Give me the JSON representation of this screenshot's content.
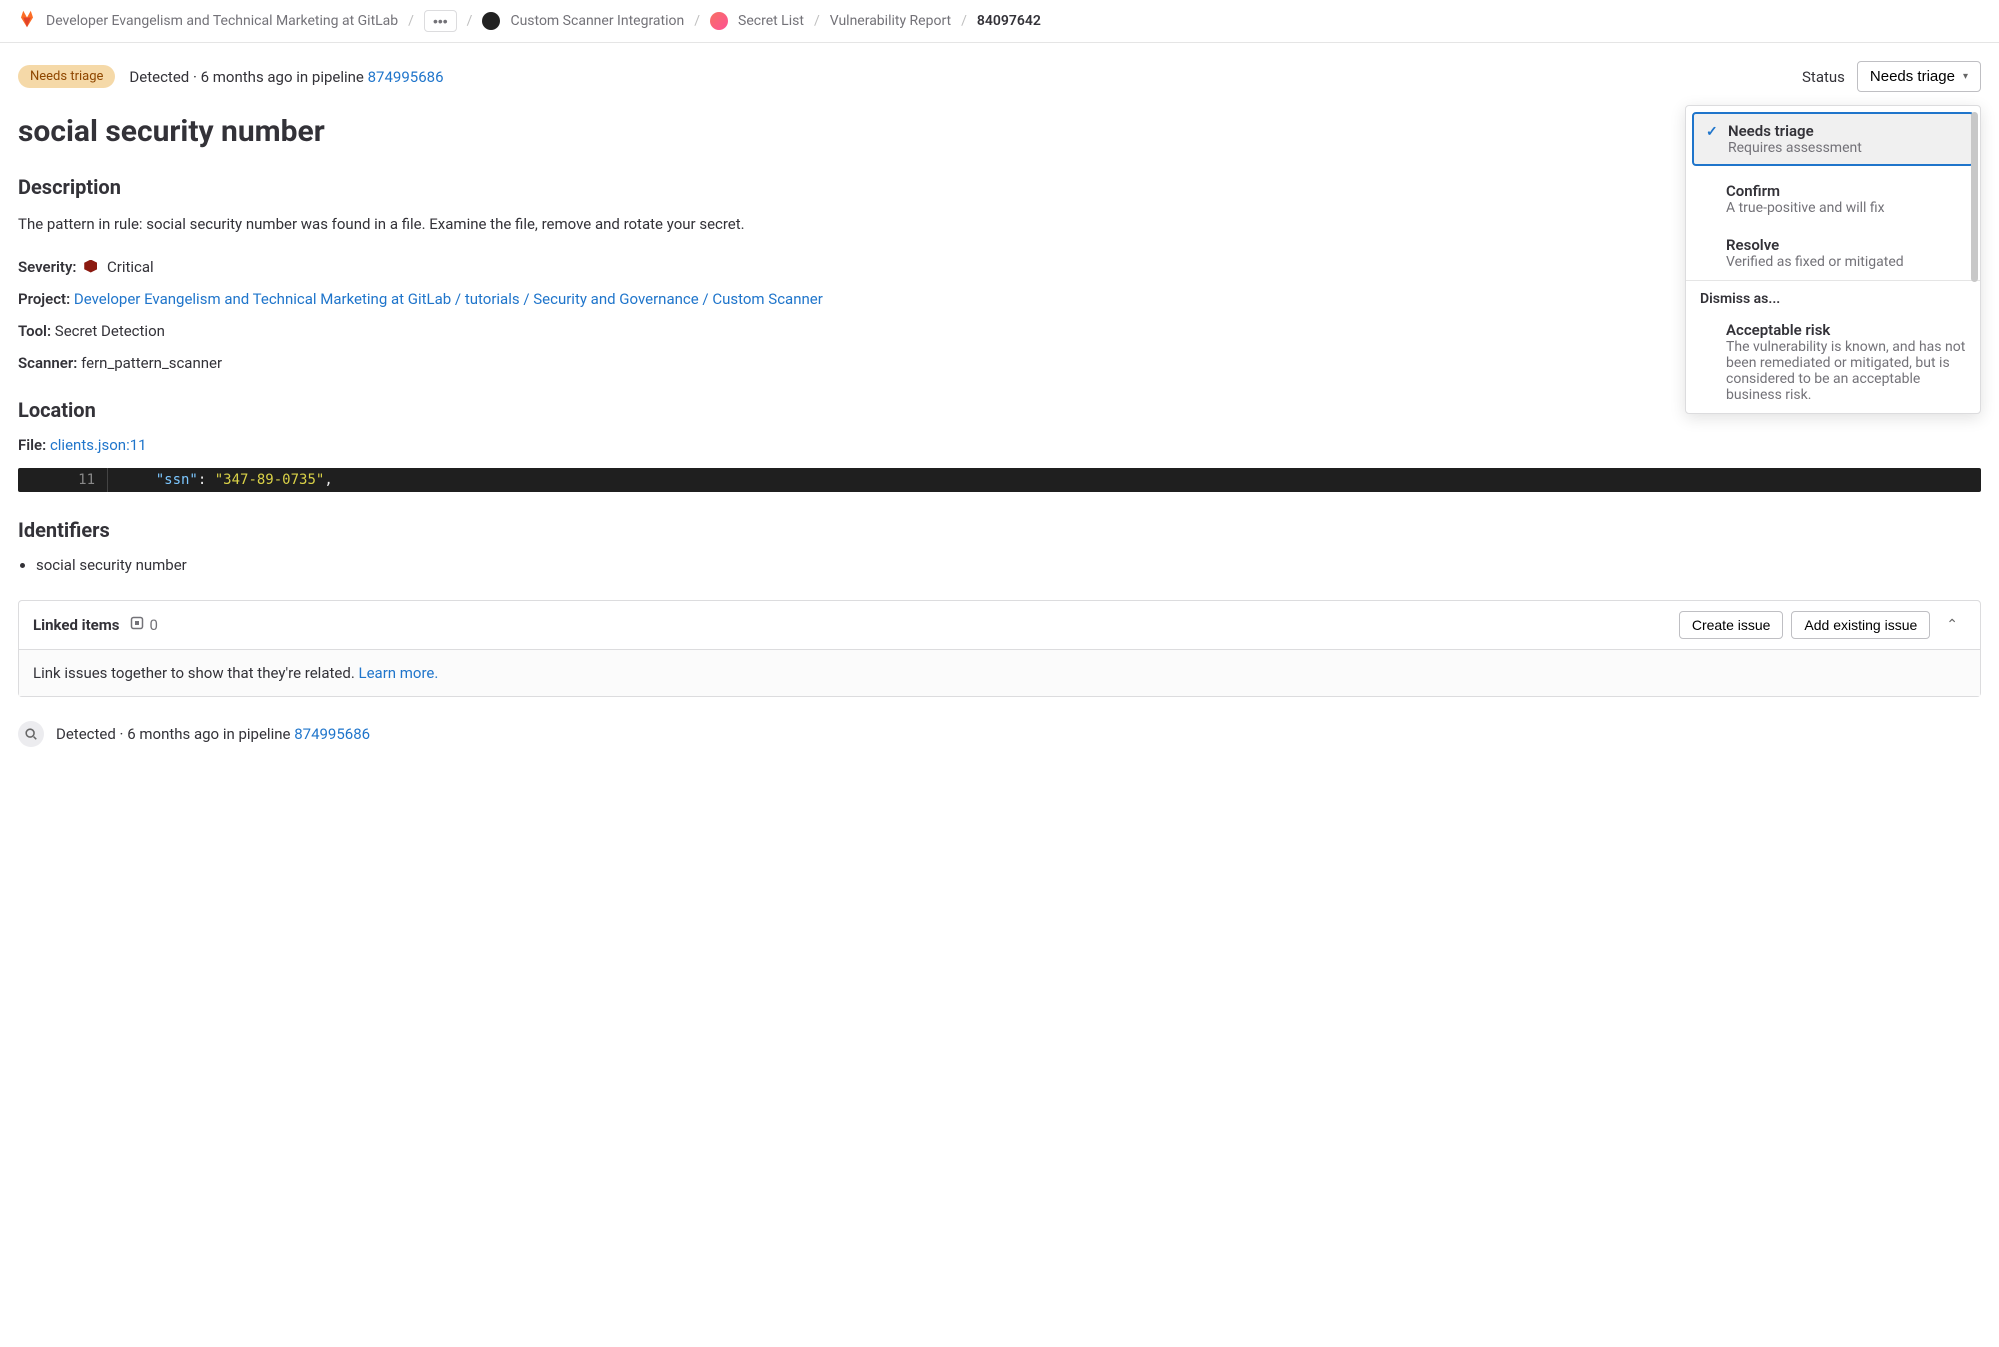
{
  "breadcrumb": {
    "root": "Developer Evangelism and Technical Marketing at GitLab",
    "project": "Custom Scanner Integration",
    "item1": "Secret List",
    "item2": "Vulnerability Report",
    "id": "84097642"
  },
  "header": {
    "badge": "Needs triage",
    "detected_prefix": "Detected · ",
    "detected_time": "6 months ago in pipeline ",
    "pipeline_id": "874995686",
    "status_label": "Status",
    "status_value": "Needs triage"
  },
  "title": "social security number",
  "description": {
    "heading": "Description",
    "text": "The pattern in rule: social security number was found in a file. Examine the file, remove and rotate your secret."
  },
  "meta": {
    "severity_label": "Severity:",
    "severity_value": "Critical",
    "project_label": "Project:",
    "project_link": "Developer Evangelism and Technical Marketing at GitLab / tutorials / Security and Governance / Custom Scanner",
    "tool_label": "Tool:",
    "tool_value": "Secret Detection",
    "scanner_label": "Scanner:",
    "scanner_value": "fern_pattern_scanner"
  },
  "location": {
    "heading": "Location",
    "file_label": "File:",
    "file_link": "clients.json:11",
    "code_line_no": "11",
    "code_key": "\"ssn\"",
    "code_colon": ": ",
    "code_value": "\"347-89-0735\"",
    "code_trail": ","
  },
  "identifiers": {
    "heading": "Identifiers",
    "items": [
      "social security number"
    ]
  },
  "linked": {
    "title": "Linked items",
    "count": "0",
    "create": "Create issue",
    "add": "Add existing issue",
    "empty_text": "Link issues together to show that they're related. ",
    "learn_more": "Learn more."
  },
  "footer": {
    "detected_prefix": "Detected · ",
    "detected_time": "6 months ago in pipeline ",
    "pipeline_id": "874995686"
  },
  "dropdown": {
    "options": [
      {
        "name": "Needs triage",
        "sub": "Requires assessment"
      },
      {
        "name": "Confirm",
        "sub": "A true-positive and will fix"
      },
      {
        "name": "Resolve",
        "sub": "Verified as fixed or mitigated"
      }
    ],
    "dismiss_header": "Dismiss as...",
    "dismiss": [
      {
        "name": "Acceptable risk",
        "sub": "The vulnerability is known, and has not been remediated or mitigated, but is considered to be an acceptable business risk."
      }
    ]
  }
}
